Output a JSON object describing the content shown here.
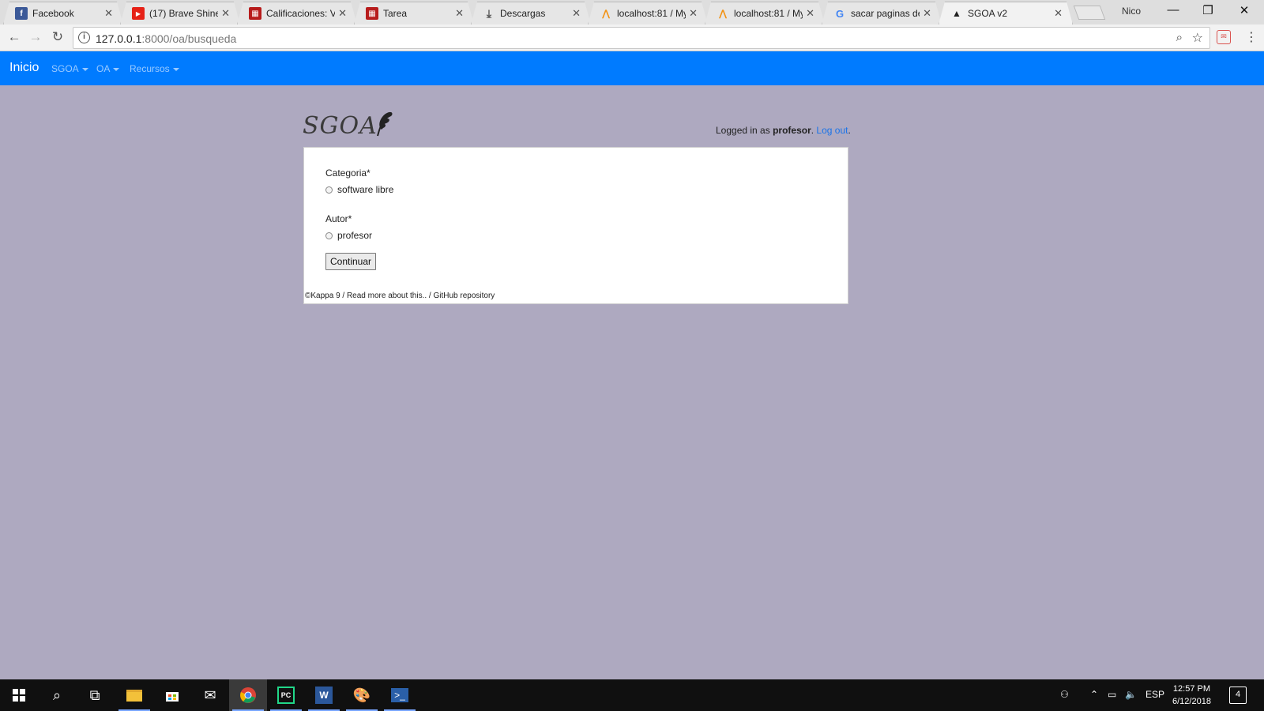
{
  "browser": {
    "tabs": [
      {
        "title": "Facebook",
        "icon": "facebook-icon",
        "color": "#3b5998",
        "glyph": "f"
      },
      {
        "title": "(17) Brave Shine",
        "icon": "youtube-icon",
        "color": "#e62117",
        "glyph": "▶"
      },
      {
        "title": "Calificaciones: Vi",
        "icon": "university-icon",
        "color": "#b71c1c",
        "glyph": "▦"
      },
      {
        "title": "Tarea",
        "icon": "university-icon",
        "color": "#b71c1c",
        "glyph": "▦"
      },
      {
        "title": "Descargas",
        "icon": "download-icon",
        "color": "#555555",
        "glyph": "⤓"
      },
      {
        "title": "localhost:81 / My",
        "icon": "phpmyadmin-icon",
        "color": "#f29111",
        "glyph": "⋀"
      },
      {
        "title": "localhost:81 / My",
        "icon": "phpmyadmin-icon",
        "color": "#f29111",
        "glyph": "⋀"
      },
      {
        "title": "sacar paginas de",
        "icon": "google-icon",
        "color": "#4285f4",
        "glyph": "G"
      },
      {
        "title": "SGOA v2",
        "icon": "graduation-cap-icon",
        "color": "#222222",
        "glyph": "🎓"
      }
    ],
    "user": "Nico",
    "url_host": "127.0.0.1",
    "url_rest": ":8000/oa/busqueda"
  },
  "navbar": {
    "brand": "Inicio",
    "items": [
      "SGOA",
      "OA",
      "Recursos"
    ]
  },
  "header": {
    "logo_text": "SGOA",
    "logged_prefix": "Logged in as ",
    "username": "profesor",
    "period": ". ",
    "logout": "Log out",
    "trail": "."
  },
  "form": {
    "categoria_label": "Categoria*",
    "categoria_option": "software libre",
    "autor_label": "Autor*",
    "autor_option": "profesor",
    "submit": "Continuar",
    "footer": "©Kappa 9 / Read more about this.. / GitHub repository"
  },
  "taskbar": {
    "language": "ESP",
    "time": "12:57 PM",
    "date": "6/12/2018",
    "notifications": "4"
  },
  "colors": {
    "navbar": "#007bff",
    "page_bg": "#aea9c0",
    "link": "#1a73e8"
  }
}
